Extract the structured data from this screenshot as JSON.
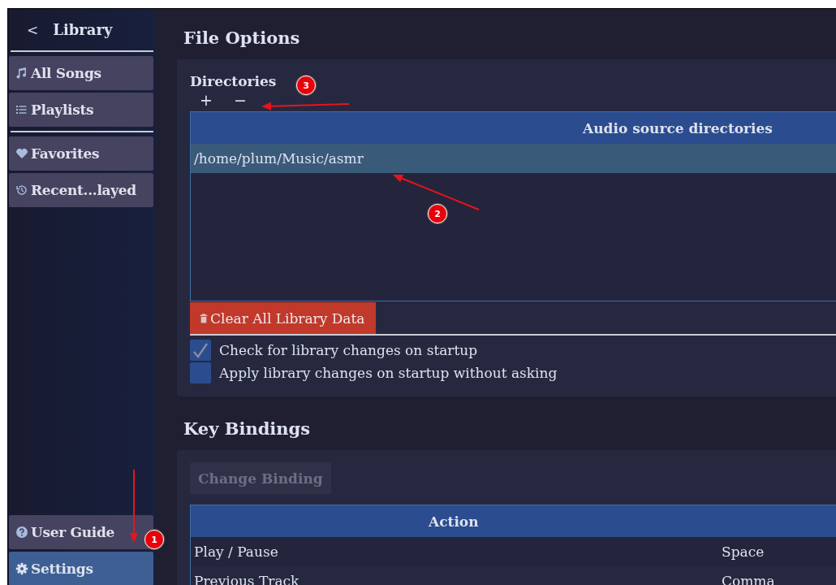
{
  "sidebar": {
    "header": {
      "back": "<",
      "title": "Library"
    },
    "groups": [
      [
        {
          "label": "All Songs",
          "selected": false
        },
        {
          "label": "Playlists",
          "selected": false
        }
      ],
      [
        {
          "label": "Favorites",
          "selected": false
        },
        {
          "label": "Recent...layed",
          "selected": false
        }
      ]
    ],
    "bottom": [
      {
        "label": "User Guide",
        "selected": false
      },
      {
        "label": "Settings",
        "selected": true
      }
    ]
  },
  "file_options": {
    "title": "File Options",
    "directories_label": "Directories",
    "add": "+",
    "remove": "−",
    "table": {
      "columns": [
        "Audio source directories"
      ],
      "rows": [
        {
          "path": "/home/plum/Music/asmr",
          "selected": true
        }
      ]
    },
    "clear_button": "Clear All Library Data",
    "checkboxes": [
      {
        "label": "Check for library changes on startup",
        "checked": true
      },
      {
        "label": "Apply library changes on startup without asking",
        "checked": false
      }
    ]
  },
  "key_bindings": {
    "title": "Key Bindings",
    "change_button": {
      "label": "Change Binding",
      "disabled": true
    },
    "table": {
      "columns": [
        "Action"
      ],
      "rows": [
        {
          "action": "Play / Pause",
          "key": "Space"
        },
        {
          "action": "Previous Track",
          "key": "Comma"
        }
      ]
    }
  },
  "annotations": [
    {
      "label": "1"
    },
    {
      "label": "2"
    },
    {
      "label": "3"
    }
  ]
}
